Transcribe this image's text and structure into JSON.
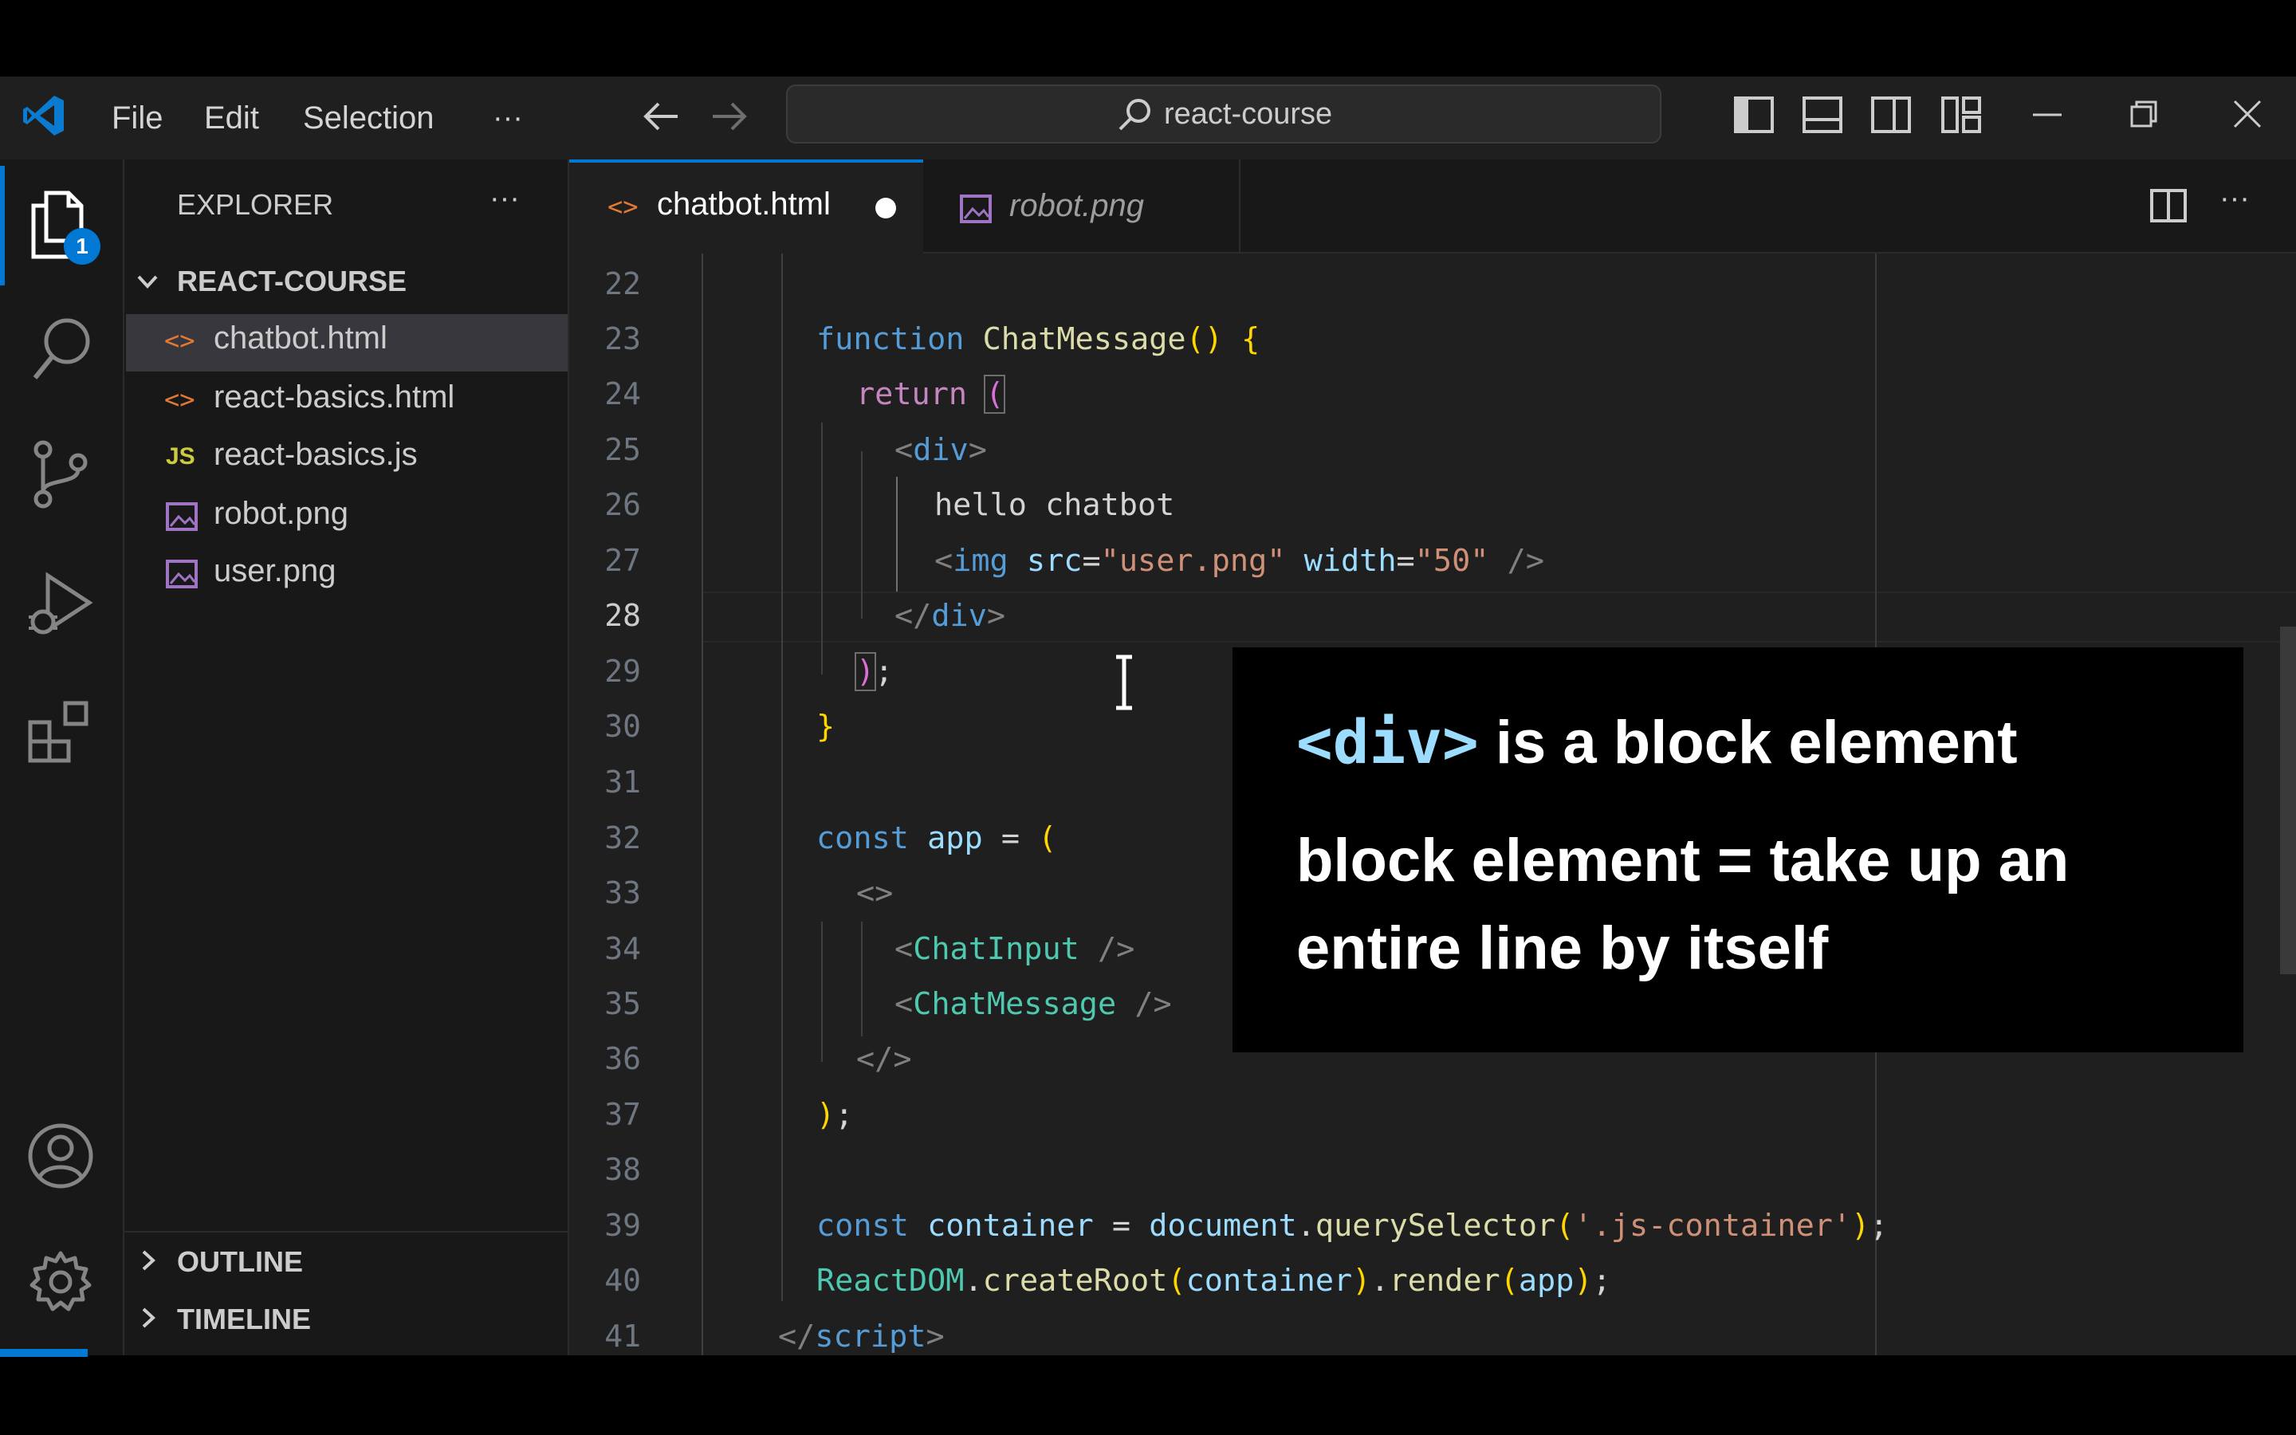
{
  "title_bar": {
    "menu": [
      "File",
      "Edit",
      "Selection",
      "···"
    ],
    "search_text": "react-course"
  },
  "activity_bar": {
    "explorer_badge": "1",
    "icons": [
      "explorer-icon",
      "search-icon",
      "source-control-icon",
      "run-debug-icon",
      "extensions-icon",
      "account-icon",
      "settings-gear-icon"
    ]
  },
  "sidebar": {
    "title": "EXPLORER",
    "more": "···",
    "folder": "REACT-COURSE",
    "files": [
      {
        "name": "chatbot.html",
        "icon": "html-file-icon",
        "glyph": "<>"
      },
      {
        "name": "react-basics.html",
        "icon": "html-file-icon",
        "glyph": "<>"
      },
      {
        "name": "react-basics.js",
        "icon": "js-file-icon",
        "glyph": "JS"
      },
      {
        "name": "robot.png",
        "icon": "image-file-icon",
        "glyph": ""
      },
      {
        "name": "user.png",
        "icon": "image-file-icon",
        "glyph": ""
      }
    ],
    "outline": "OUTLINE",
    "timeline": "TIMELINE"
  },
  "tabs": [
    {
      "label": "chatbot.html",
      "glyph": "<>",
      "modified": true
    },
    {
      "label": "robot.png"
    }
  ],
  "editor": {
    "line_numbers": [
      "22",
      "23",
      "24",
      "25",
      "26",
      "27",
      "28",
      "29",
      "30",
      "31",
      "32",
      "33",
      "34",
      "35",
      "36",
      "37",
      "38",
      "39",
      "40",
      "41"
    ],
    "current_line": "28"
  },
  "overlay": {
    "line1_code": "<div>",
    "line1_text": " is a block element",
    "line2": "block element = take up an",
    "line3": "entire line by itself"
  },
  "colors": {
    "accent": "#0078d4",
    "html_icon": "#e37933",
    "js_icon": "#cbcb41",
    "image_icon": "#a074c4",
    "badge": "#0078d4"
  }
}
